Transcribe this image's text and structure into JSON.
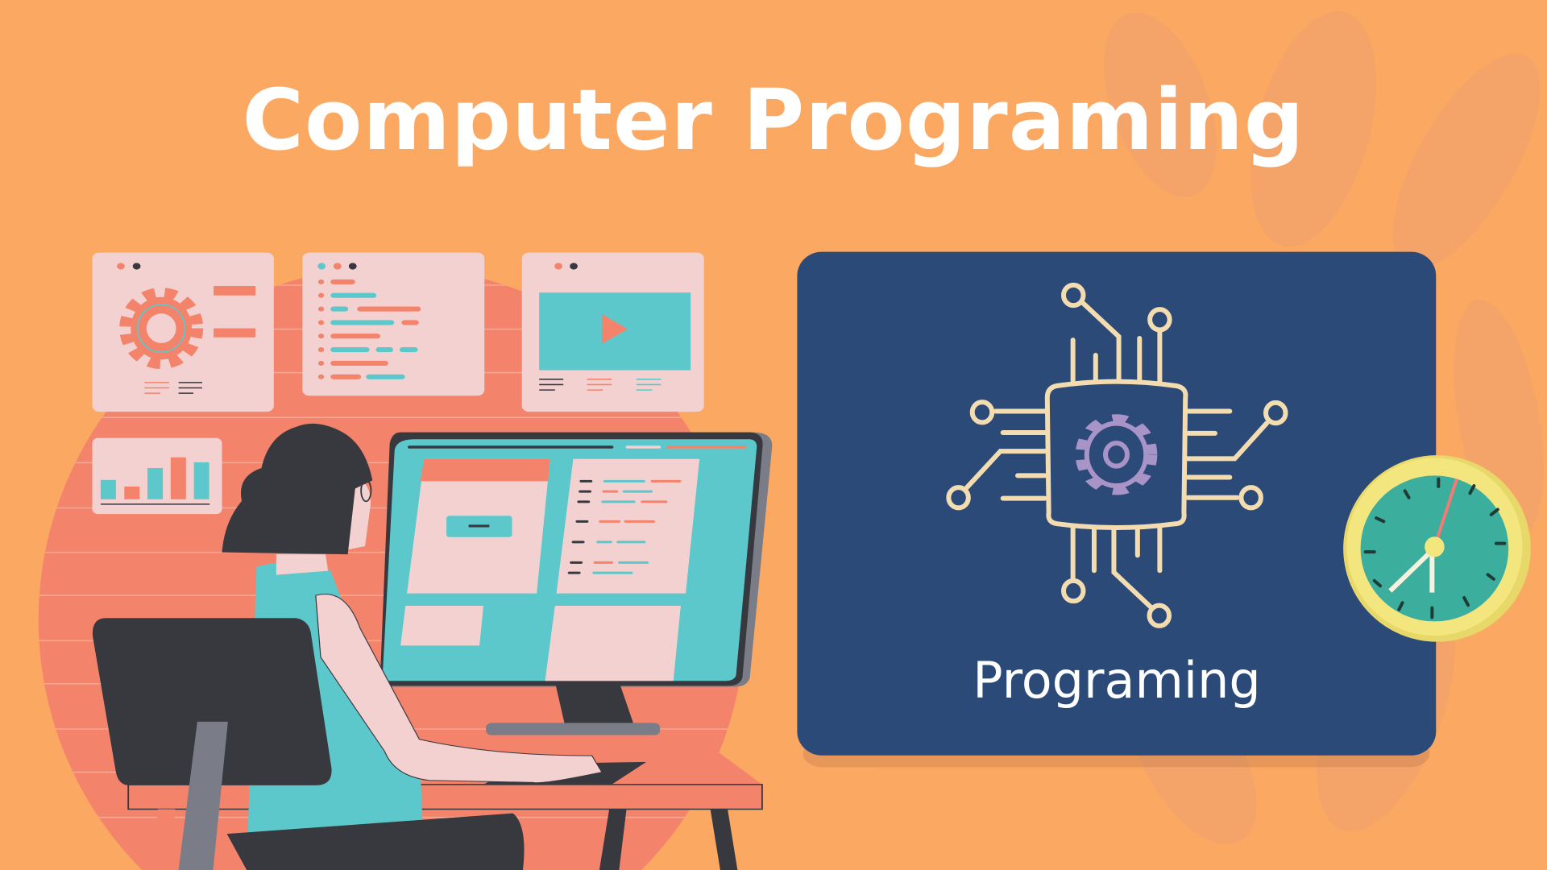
{
  "header": {
    "title": "Computer Programing"
  },
  "card": {
    "label": "Programing",
    "icon": "circuit-chip-gear-icon"
  },
  "clock": {
    "icon": "clock-icon"
  },
  "illustration": {
    "icon": "woman-at-computer-illustration"
  },
  "colors": {
    "background": "#FBA862",
    "card": "#2B4A78",
    "salmon": "#F4836B",
    "teal": "#5DC8CB",
    "pink": "#F3D1D1",
    "dark": "#38383F",
    "chip": "#F3DDB0",
    "gear": "#A994C8"
  }
}
